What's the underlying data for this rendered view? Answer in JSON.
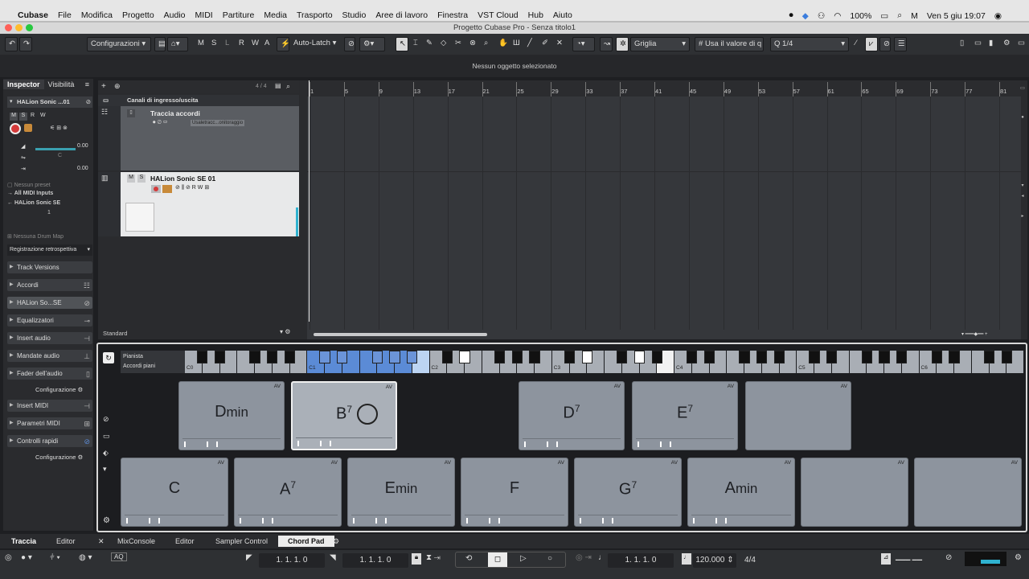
{
  "mac_menu": {
    "apple": "",
    "items": [
      "Cubase",
      "File",
      "Modifica",
      "Progetto",
      "Audio",
      "MIDI",
      "Partiture",
      "Media",
      "Trasporto",
      "Studio",
      "Aree di lavoro",
      "Finestra",
      "VST Cloud",
      "Hub",
      "Aiuto"
    ],
    "battery": "100%",
    "datetime": "Ven 5 giu  19:07"
  },
  "window": {
    "title": "Progetto Cubase Pro - Senza titolo1"
  },
  "toolbar": {
    "config": "Configurazioni",
    "automation_mode": "Auto-Latch",
    "snap_type": "Griglia",
    "quantize_mode": "Usa il valore di q",
    "quantize_value": "1/4",
    "btn_m": "M",
    "btn_s": "S",
    "btn_l": "L",
    "btn_r": "R",
    "btn_w": "W",
    "btn_a": "A"
  },
  "info_line": {
    "text": "Nessun oggetto selezionato"
  },
  "inspector": {
    "tab_inspector": "Inspector",
    "tab_visibility": "Visibilità",
    "track_name": "HALion Sonic ...01",
    "volume": "0.00",
    "pan": "C",
    "delay": "0.00",
    "preset": "Nessun preset",
    "input": "All MIDI Inputs",
    "output": "HALion Sonic SE",
    "channel": "1",
    "drum_map": "Nessuna Drum Map",
    "retro": "Registrazione retrospettiva",
    "sections": [
      {
        "label": "Track Versions"
      },
      {
        "label": "Accordi"
      },
      {
        "label": "HALion So...SE"
      },
      {
        "label": "Equalizzatori"
      },
      {
        "label": "Insert audio"
      },
      {
        "label": "Mandate audio"
      },
      {
        "label": "Fader dell'audio"
      },
      {
        "label": "Insert MIDI"
      },
      {
        "label": "Parametri MIDI"
      },
      {
        "label": "Controlli rapidi"
      }
    ],
    "config1": "Configurazione",
    "config2": "Configurazione"
  },
  "tracklist": {
    "count": "4 / 4",
    "folder": "Canali di ingresso/uscita",
    "chord_track": "Traccia accordi",
    "chord_track_plugin": "Usaletracc...onitoraggio",
    "instrument_track": "HALion Sonic SE 01",
    "preset_label": "Standard"
  },
  "ruler": {
    "bars": [
      "1",
      "5",
      "9",
      "13",
      "17",
      "21",
      "25",
      "29",
      "33",
      "37",
      "41",
      "45",
      "49",
      "53",
      "57",
      "61",
      "65",
      "69",
      "73",
      "77",
      "81"
    ]
  },
  "chord_pads": {
    "player_label": "Pianista",
    "player_value": "Accordi piani",
    "octaves": [
      "C0",
      "C1",
      "C2",
      "C3",
      "C4",
      "C5",
      "C6"
    ],
    "top_row": [
      {
        "root": "D",
        "quality": "min"
      },
      {
        "root": "B",
        "quality": "7"
      },
      {
        "root": "",
        "quality": ""
      },
      {
        "root": "D",
        "quality": "7"
      },
      {
        "root": "E",
        "quality": "7"
      },
      {
        "root": "",
        "quality": ""
      }
    ],
    "bottom_row": [
      {
        "root": "C",
        "quality": ""
      },
      {
        "root": "A",
        "quality": "7"
      },
      {
        "root": "E",
        "quality": "min"
      },
      {
        "root": "F",
        "quality": ""
      },
      {
        "root": "G",
        "quality": "7"
      },
      {
        "root": "A",
        "quality": "min"
      },
      {
        "root": "",
        "quality": ""
      },
      {
        "root": "",
        "quality": ""
      }
    ],
    "av": "AV"
  },
  "bottom_tabs": {
    "traccia": "Traccia",
    "editor1": "Editor",
    "mixconsole": "MixConsole",
    "editor2": "Editor",
    "sampler": "Sampler Control",
    "chordpad": "Chord Pad"
  },
  "transport": {
    "left_locator": "1. 1. 1.   0",
    "right_locator": "1. 1. 1.   0",
    "position": "1. 1. 1.   0",
    "tempo": "120.000",
    "signature": "4/4"
  },
  "colors": {
    "accent_blue": "#5b8bd6",
    "pad": "#8d949e",
    "record": "#d43a3a"
  }
}
